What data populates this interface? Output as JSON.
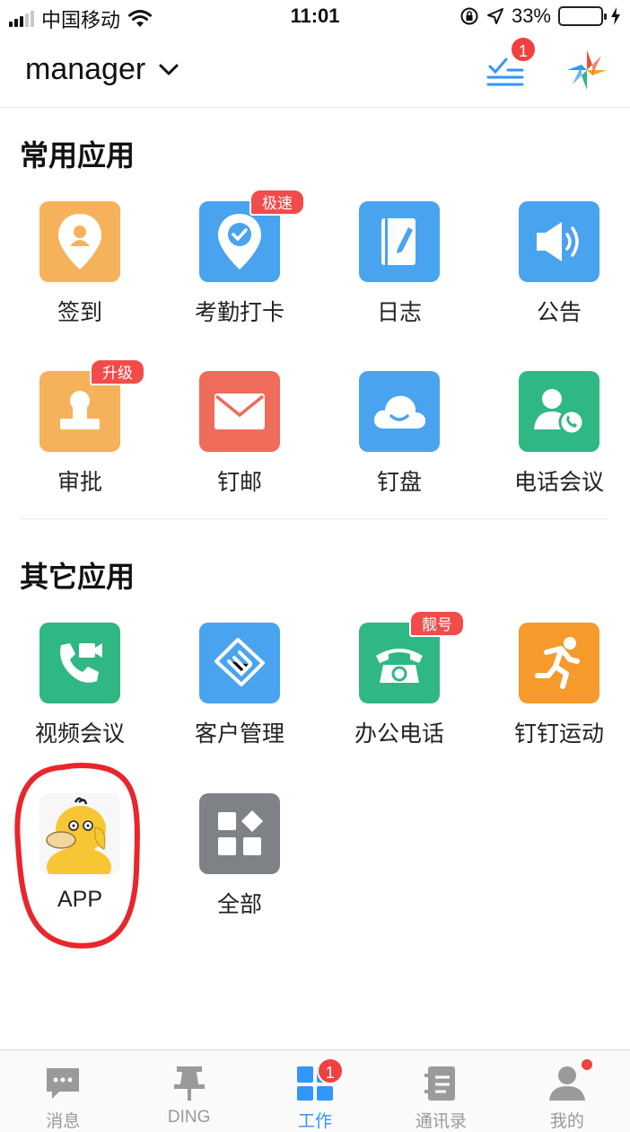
{
  "status_bar": {
    "carrier": "中国移动",
    "time": "11:01",
    "battery_percent": "33%",
    "battery_level": 0.33,
    "icons": [
      "signal-icon",
      "wifi-icon",
      "rotation-lock-icon",
      "location-icon",
      "battery-icon",
      "charging-icon"
    ]
  },
  "header": {
    "org_name": "manager",
    "todo_badge": "1",
    "icons": [
      "chevron-down-icon",
      "todo-list-icon",
      "dingtalk-logo-icon"
    ]
  },
  "sections": {
    "common": {
      "title": "常用应用",
      "apps": [
        {
          "label": "签到",
          "icon": "checkin-icon",
          "color": "#f5b25b"
        },
        {
          "label": "考勤打卡",
          "icon": "attendance-icon",
          "color": "#4aa3ef",
          "tag": "极速"
        },
        {
          "label": "日志",
          "icon": "log-icon",
          "color": "#4aa3ef"
        },
        {
          "label": "公告",
          "icon": "announcement-icon",
          "color": "#4aa3ef"
        },
        {
          "label": "审批",
          "icon": "approval-icon",
          "color": "#f5b25b",
          "tag": "升级"
        },
        {
          "label": "钉邮",
          "icon": "mail-icon",
          "color": "#ef6b5a"
        },
        {
          "label": "钉盘",
          "icon": "cloud-drive-icon",
          "color": "#4aa3ef"
        },
        {
          "label": "电话会议",
          "icon": "phone-conference-icon",
          "color": "#2fb784"
        }
      ]
    },
    "other": {
      "title": "其它应用",
      "apps": [
        {
          "label": "视频会议",
          "icon": "video-conference-icon",
          "color": "#2fb784"
        },
        {
          "label": "客户管理",
          "icon": "customer-management-icon",
          "color": "#4aa3ef"
        },
        {
          "label": "办公电话",
          "icon": "office-phone-icon",
          "color": "#2fb784",
          "tag": "靓号"
        },
        {
          "label": "钉钉运动",
          "icon": "sport-icon",
          "color": "#f59a2b"
        },
        {
          "label": "APP",
          "icon": "psyduck-app-icon",
          "color": "#f5f5f5"
        },
        {
          "label": "全部",
          "icon": "all-apps-icon",
          "color": "#7e8287"
        }
      ]
    }
  },
  "tab_bar": {
    "tabs": [
      {
        "label": "消息",
        "icon": "message-icon"
      },
      {
        "label": "DING",
        "icon": "ding-pin-icon"
      },
      {
        "label": "工作",
        "icon": "work-grid-icon",
        "badge": "1",
        "active": true
      },
      {
        "label": "通讯录",
        "icon": "contacts-icon"
      },
      {
        "label": "我的",
        "icon": "profile-icon"
      }
    ]
  },
  "colors": {
    "accent": "#3296fa",
    "badge_red": "#f04040",
    "annotation_red": "#e8262b"
  }
}
